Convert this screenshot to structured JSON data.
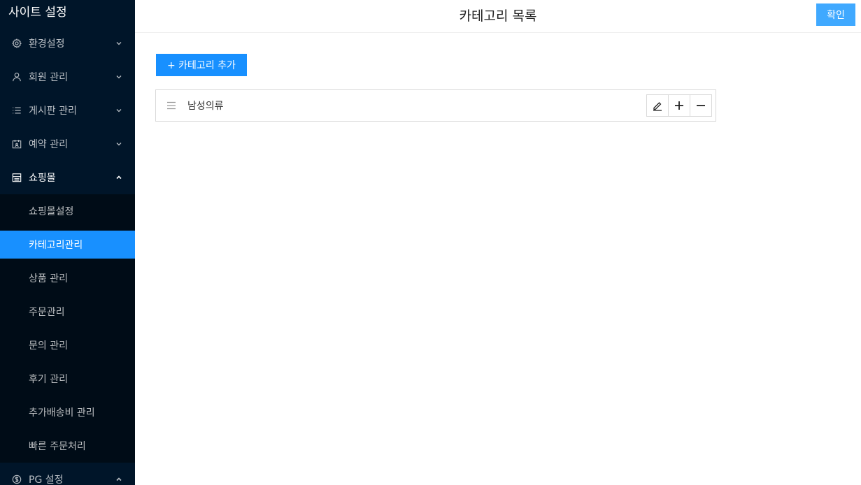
{
  "sidebar": {
    "title": "사이트 설정",
    "menu": [
      {
        "label": "환경설정",
        "icon": "gear-icon"
      },
      {
        "label": "회원 관리",
        "icon": "user-icon"
      },
      {
        "label": "게시판 관리",
        "icon": "list-icon"
      },
      {
        "label": "예약 관리",
        "icon": "calendar-icon"
      },
      {
        "label": "쇼핑몰",
        "icon": "shop-icon"
      }
    ],
    "shop_submenu": [
      {
        "label": "쇼핑몰설정"
      },
      {
        "label": "카테고리관리"
      },
      {
        "label": "상품 관리"
      },
      {
        "label": "주문관리"
      },
      {
        "label": "문의 관리"
      },
      {
        "label": "후기 관리"
      },
      {
        "label": "추가배송비 관리"
      },
      {
        "label": "빠른 주문처리"
      }
    ],
    "pg": {
      "label": "PG 설정",
      "icon": "dollar-icon"
    }
  },
  "header": {
    "title": "카테고리 목록",
    "confirm_label": "확인"
  },
  "content": {
    "add_label": "+ 카테고리 추가",
    "categories": [
      {
        "name": "남성의류"
      }
    ]
  },
  "colors": {
    "sidebar_bg": "#001529",
    "submenu_bg": "#000c17",
    "accent": "#1890ff",
    "confirm_bg": "#40a9ff"
  }
}
